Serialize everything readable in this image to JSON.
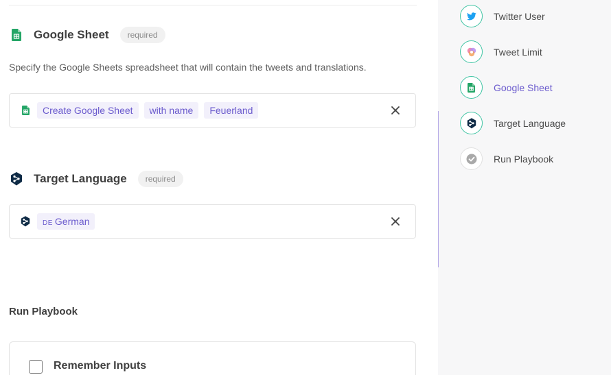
{
  "google_sheet": {
    "title": "Google Sheet",
    "badge": "required",
    "description": "Specify the Google Sheets spreadsheet that will contain the tweets and translations.",
    "chips": [
      "Create Google Sheet",
      "with name",
      "Feuerland"
    ],
    "icon": "google-sheets-icon"
  },
  "target_language": {
    "title": "Target Language",
    "badge": "required",
    "chip_code": "DE",
    "chip_label": "German",
    "icon": "deepl-icon"
  },
  "run_playbook": {
    "title": "Run Playbook",
    "remember_label": "Remember Inputs"
  },
  "sidebar": {
    "steps": [
      {
        "label": "Twitter User",
        "icon": "twitter-icon",
        "state": "done"
      },
      {
        "label": "Tweet Limit",
        "icon": "tweet-limit-icon",
        "state": "done"
      },
      {
        "label": "Google Sheet",
        "icon": "google-sheets-icon",
        "state": "active"
      },
      {
        "label": "Target Language",
        "icon": "deepl-icon",
        "state": "done"
      },
      {
        "label": "Run Playbook",
        "icon": "check-icon",
        "state": "pending"
      }
    ]
  },
  "colors": {
    "accent": "#6a5acd",
    "step_done": "#3fc4a3",
    "sheets_green": "#23a566",
    "deepl_navy": "#0f2b46",
    "twitter_blue": "#1da1f2"
  }
}
